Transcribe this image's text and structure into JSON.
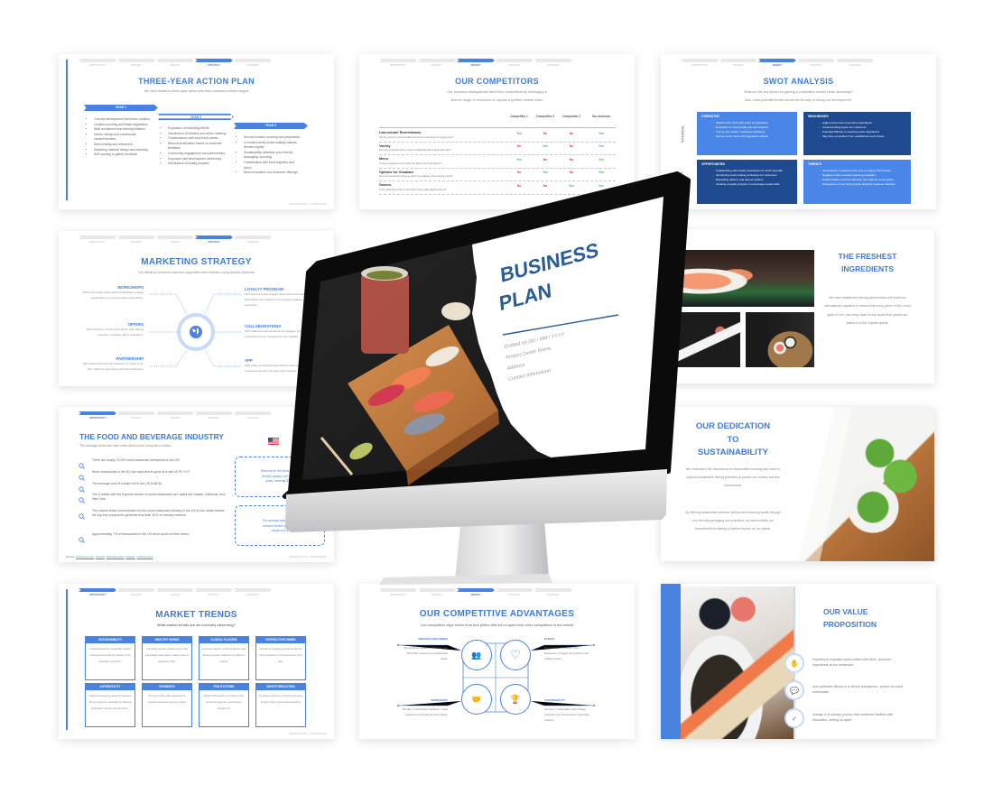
{
  "nav_steps": [
    "OPPORTUNITY",
    "PROJECT",
    "MARKET",
    "STRATEGY",
    "FINANCES"
  ],
  "footer": "BUSINESS PLAN - CONFIDENTIAL",
  "colors": {
    "accent": "#3d7be0",
    "navy": "#1f4a8f",
    "cover_blue": "#2a5c95",
    "yes": "#4caf50",
    "no": "#e53935"
  },
  "action_plan": {
    "active_step": "STRATEGY",
    "title": "THREE-YEAR ACTION PLAN",
    "subtitle": "We have devised a three-year action plan that comprises multiple stages",
    "years": [
      {
        "label": "YEAR 1",
        "items": [
          "Concept development and menu creation.",
          "Location scouting and lease negotiation.",
          "Staff recruitment and training initiation.",
          "Interior design and construction commencement.",
          "Menu testing and refinement.",
          "Marketing material design and branding.",
          "Soft opening to gather feedback."
        ]
      },
      {
        "label": "YEAR 2",
        "items": [
          "Expansion of marketing efforts.",
          "Introduction of delivery and online ordering.",
          "Collaborations with local food events.",
          "Menu diversification based on customer feedback.",
          "Community engagement and partnerships.",
          "Employee skill development workshops.",
          "Introduction of loyalty program."
        ]
      },
      {
        "label": "YEAR 3",
        "items": [
          "Second location scouting and preparation.",
          "In-house events (sushi-making classes, themed nights).",
          "Sustainability initiatives (eco-friendly packaging, sourcing).",
          "Collaboration with local suppliers and farms.",
          "Menu innovation and seasonal offerings."
        ]
      }
    ]
  },
  "competitors": {
    "active_step": "MARKET",
    "title": "OUR COMPETITORS",
    "subtitle": [
      "Our business distinguishes itself from competitors by leveraging a",
      "diverse range of resources to capture a greater market share"
    ],
    "columns": [
      "Competitor 1",
      "Competitor 2",
      "Competitor 3",
      "Our business"
    ],
    "rows": [
      {
        "title": "Last-minute Reservations",
        "question": "Can the company accommodate last-minute reservations for large groups?",
        "values": [
          "Yes",
          "No",
          "No",
          "Yes"
        ]
      },
      {
        "title": "Variety",
        "question": "Does the restaurant offer a variety of traditional and modern sushi rolls?",
        "values": [
          "No",
          "Yes",
          "No",
          "Yes"
        ]
      },
      {
        "title": "Menu",
        "question": "Is there a separate menu section for gluten-free sushi options?",
        "values": [
          "Yes",
          "No",
          "No",
          "Yes"
        ]
      },
      {
        "title": "Options for Omakase",
        "question": "Does the restaurant provide an option for omakase (chef's tasting menu)?",
        "values": [
          "No",
          "Yes",
          "No",
          "Yes"
        ]
      },
      {
        "title": "Sauces",
        "question": "Is the restaurant known for its unique house-made dipping sauces?",
        "values": [
          "No",
          "No",
          "Yes",
          "Yes"
        ]
      }
    ]
  },
  "swot": {
    "active_step": "MARKET",
    "title": "SWOT ANALYSIS",
    "subtitle": [
      "What are the key factors for gaining a competitive market share advantage?",
      "Also, what potential threats should we be wary of during our development?"
    ],
    "axis": [
      "INTERNAL",
      "EXTERNAL"
    ],
    "quadrants": [
      {
        "label": "STRENGTHS",
        "items": [
          "Skilled sushi chefs with years of experience",
          "Emphasis on using locally sourced seafood",
          "Trendy and modern restaurant ambiance",
          "Diverse sushi menu with vegetarian options"
        ]
      },
      {
        "label": "WEAKNESSES",
        "items": [
          "Higher prices due to premium ingredients",
          "Limited parking space for customers",
          "Potential difficulty in sourcing exotic ingredients",
          "May face competition from established sushi chains"
        ]
      },
      {
        "label": "OPPORTUNITIES",
        "items": [
          "Collaborating with nearby businesses for lunch specials",
          "Introducing sushi-making workshops for customers",
          "Expanding delivery and takeout options",
          "Creating a loyalty program to encourage repeat visits"
        ]
      },
      {
        "label": "THREATS",
        "items": [
          "Fluctuations in seafood prices due to supply chain issues",
          "Negative online reviews impacting reputation",
          "Health-related concerns affecting raw seafood consumption",
          "Emergence of new dining trends diverting customer attention"
        ]
      }
    ]
  },
  "marketing": {
    "active_step": "STRATEGY",
    "title": "MARKETING STRATEGY",
    "subtitle": "Our efforts to enhance customer acquisition and retention using diverse channels",
    "left": [
      {
        "title": "WORKSHOPS",
        "text": "We'll host monthly sushi-making workshops to engage and educate our customers about sushi artistry."
      },
      {
        "title": "OFFERS",
        "text": "We'll introduce a \"Sushi of the Month\" club, offering exclusive, innovative rolls to subscribers."
      },
      {
        "title": "PARTNERSHIP",
        "text": "We'll partner with local fish markets for a \"Catch of the Day\" sushi roll, supporting community businesses."
      }
    ],
    "right": [
      {
        "title": "LOYALTY PROGRAM",
        "text": "We'll launch a loyalty program where customers collect sushi stamps for a chance to win a deluxe omakase experience."
      },
      {
        "title": "COLLABORATIONS",
        "text": "We'll collaborate with renowned food bloggers for a sushi-tasting event, creating buzz and credibility."
      },
      {
        "title": "APP",
        "text": "We'll create an interactive app that lets customers customize and name their own sushi creations."
      }
    ]
  },
  "industry": {
    "active_step": "OPPORTUNITY",
    "title": "THE FOOD AND BEVERAGE INDUSTRY",
    "subtitle": "The average American eats sushi about once every two months",
    "facts": [
      "There are nearly 20,000 sushi restaurant enterprises in the US.",
      "Sushi restaurants in the US are expected to grow at a rate of 2% YOY.",
      "The average cost of a sushi roll in the US is $8.50.",
      "The 3 states with the highest number of sushi restaurants per capita are Hawaii, California, and New York.",
      "The market share concentration for the sushi restaurant industry in the US is low, which means the top four companies generate less than 40% of industry revenue.",
      "Approximately 7% of restaurants in the US serve sushi on their menu."
    ],
    "callouts": [
      [
        "Revenue for the Sushi Restau",
        "trended upward over most o",
        "years, reaching $28 B"
      ],
      [
        "The average sushi restaura",
        "annual revenue of $500,00",
        "margin of 6-8"
      ]
    ],
    "sources_label": "Sources:",
    "sources": [
      "Qsrbusiness.com,",
      "ibisworld,",
      "databridgemarket,",
      "ibisworld,",
      "foodtruckempire"
    ]
  },
  "trends": {
    "active_step": "OPPORTUNITY",
    "title": "MARKET TRENDS",
    "subtitle": "What market trends are we currently observing?",
    "cards": [
      {
        "title": "SUSTAINABILITY",
        "text": "Growing demand for sustainable seafood sourcing and eco-friendly practices in the restaurant's operations."
      },
      {
        "title": "HEALTHY DINING",
        "text": "Increasing consumer preference for fresh and healthier food options, making sushi an appealing choice."
      },
      {
        "title": "GLOBAL FLAVORS",
        "text": "Consumer interest in exploring diverse sushi flavors and fusion variations from different cuisines."
      },
      {
        "title": "INTERACTIVE DINING",
        "text": "Demand for engaging experiences like live sushi preparation or chef interactions at the table."
      },
      {
        "title": "AUTHENTICITY",
        "text": "Customers seeking an authentic Japanese dining experience, emphasizing traditional preparation methods and ingredients."
      },
      {
        "title": "PAYMENTS",
        "text": "NFC and mobile wallet integration for seamless and secure payment options."
      },
      {
        "title": "POS SYSTEMS",
        "text": "Modern POS solutions for efficient order processing, payment, and inventory management."
      },
      {
        "title": "WASTE REDUCTION",
        "text": "Innovative solutions to minimize food waste through portion control and composting."
      }
    ]
  },
  "advantages": {
    "active_step": "MARKET",
    "title": "OUR COMPETITIVE ADVANTAGES",
    "subtitle": "Our competitive edge stems from four pillars that set us apart from other competitors in the market",
    "pillars": [
      {
        "title": "PERSONALIZED DINING",
        "text": "We provide an interactive \"Build Your Own Sushi Roll\" experience for personalized dining.",
        "icon": "people-check-icon"
      },
      {
        "title": "EVENTS",
        "text": "We introduce a \"Kids Sushi Chef Experience\" to engage young diners in the culinary process.",
        "icon": "heart-icon"
      },
      {
        "title": "WORKSHOPS",
        "text": "We offer a \"Sushi Artistry Workshop,\" letting customers try their hand at sushi crafting.",
        "icon": "handshake-icon"
      },
      {
        "title": "SUSTAINABILITY",
        "text": "We have a \"Sustainability Sushi Pledge,\" showcasing our commitment to responsible sourcing.",
        "icon": "trophy-icon"
      }
    ]
  },
  "value": {
    "title": [
      "OUR VALUE",
      "PROPOSITION"
    ],
    "points": [
      {
        "text": "Experience exquisite sushi crafted with fresh, premium ingredients at our restaurant.",
        "icon": "hand-coins-icon"
      },
      {
        "text": "avor authentic flavors in a vibrant atmosphere, perfect for sushi enthusiasts.",
        "icon": "chat-icon"
      },
      {
        "text": "Indulge in a culinary journey that combines tradition with innovation, setting us apart.",
        "icon": "check-icon"
      }
    ]
  },
  "freshest": {
    "title": [
      "THE FRESHEST",
      "INGREDIENTS"
    ],
    "text": "We have established strong partnerships with local and international suppliers to ensure that every piece of fish, every grain of rice, and every dash of soy sauce that graces our plates is of the highest quality."
  },
  "sustainability": {
    "title": [
      "OUR DEDICATION",
      "TO",
      "SUSTAINABILITY"
    ],
    "paragraphs": [
      "We understand the importance of responsible sourcing and strive to support sustainable fishing practices to protect our oceans and the environment.",
      "By offering sustainable seafood options and reducing waste through eco-friendly packaging and practices, we demonstrate our commitment to making a positive impact on our planet."
    ]
  },
  "cover": {
    "title": [
      "BUSINESS",
      "PLAN"
    ],
    "details": [
      "Drafted  on DD / MM / YYYY",
      "Project Owner Name",
      "Address",
      "Contact information"
    ]
  }
}
